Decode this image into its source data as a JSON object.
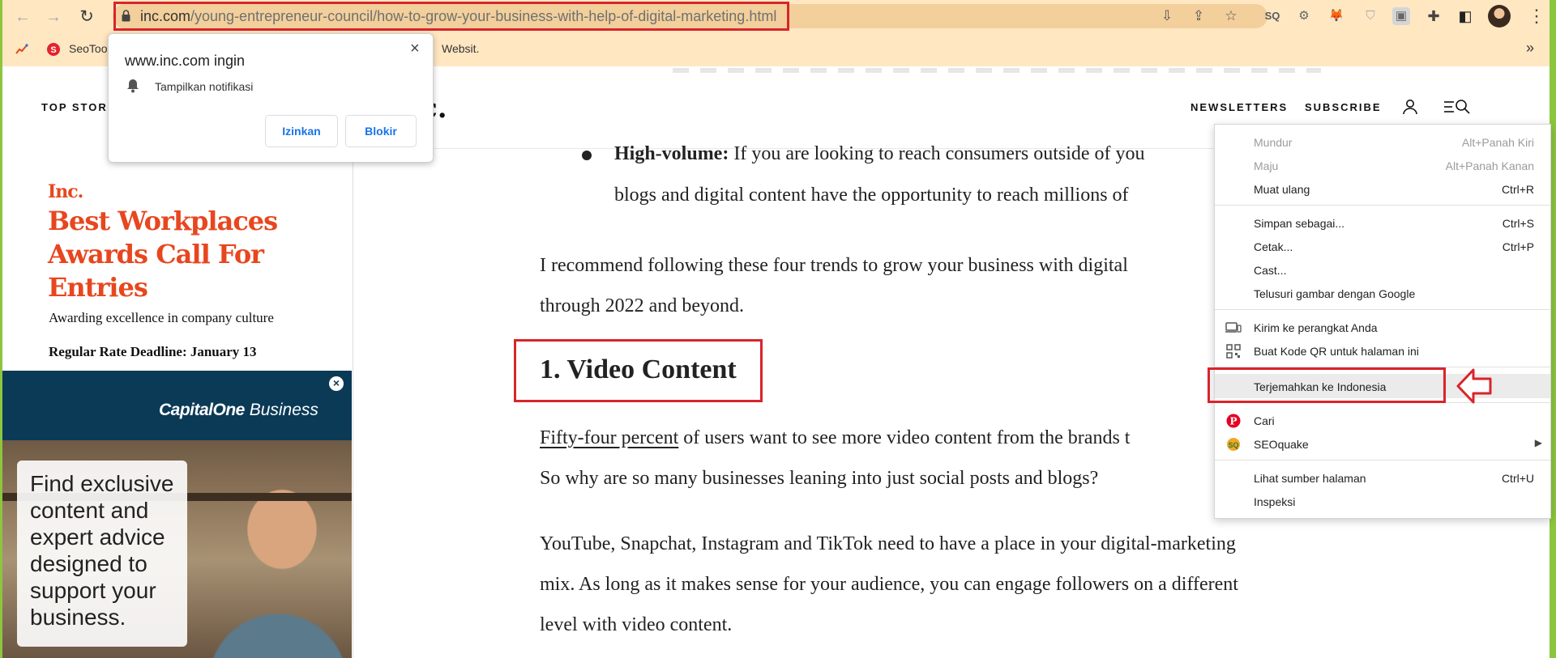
{
  "toolbar": {
    "url_host": "inc.com",
    "url_path": "/young-entrepreneur-council/how-to-grow-your-business-with-help-of-digital-marketing.html",
    "icons": [
      "back-icon",
      "forward-icon",
      "reload-icon",
      "lock-icon",
      "install-icon",
      "share-icon",
      "star-icon",
      "seoquake-icon",
      "extension-gear-icon",
      "metamask-icon",
      "shield-extension-icon",
      "extension-icon",
      "puzzle-icon",
      "side-panel-icon",
      "avatar",
      "kebab-menu-icon"
    ]
  },
  "bookmarks": {
    "items": [
      {
        "label": "SeoToo"
      },
      {
        "label": "Websit."
      }
    ],
    "overflow": "»"
  },
  "notification": {
    "title": "www.inc.com ingin",
    "text": "Tampilkan notifikasi",
    "allow_label": "Izinkan",
    "block_label": "Blokir",
    "close": "×"
  },
  "header": {
    "top_stories": "TOP STOR",
    "logo_tail": "c.",
    "newsletters": "NEWSLETTERS",
    "subscribe": "SUBSCRIBE"
  },
  "promo": {
    "brand": "Inc.",
    "title": "Best Workplaces Awards Call For Entries",
    "subtitle": "Awarding excellence in company culture",
    "deadline": "Regular Rate Deadline: January 13"
  },
  "ad": {
    "brand_a": "CapitalOne",
    "brand_b": "Business",
    "card_text": "Find exclusive content and expert advice designed to support your business."
  },
  "article": {
    "bullet_lead": "High-volume:",
    "bullet_line1": " If you are looking to reach consumers outside of you",
    "bullet_line2": "blogs and digital content have the opportunity to reach millions of",
    "para1_line1": "I recommend following these four trends to grow your business with digital",
    "para1_line2": "through 2022 and beyond.",
    "heading": "1. Video Content",
    "para2_link": "Fifty-four percent",
    "para2_line1_rest": " of users want to see more video content from the brands t",
    "para2_line2": "So why are so many businesses leaning into just social posts and blogs?",
    "para3_line1": "YouTube, Snapchat, Instagram and TikTok need to have a place in your digital-marketing",
    "para3_line2": "mix. As long as it makes sense for your audience, you can engage followers on a different",
    "para3_line3": "level with video content."
  },
  "context_menu": {
    "back": {
      "label": "Mundur",
      "shortcut": "Alt+Panah Kiri"
    },
    "forward": {
      "label": "Maju",
      "shortcut": "Alt+Panah Kanan"
    },
    "reload": {
      "label": "Muat ulang",
      "shortcut": "Ctrl+R"
    },
    "save_as": {
      "label": "Simpan sebagai...",
      "shortcut": "Ctrl+S"
    },
    "print": {
      "label": "Cetak...",
      "shortcut": "Ctrl+P"
    },
    "cast": {
      "label": "Cast..."
    },
    "search_image": {
      "label": "Telusuri gambar dengan Google"
    },
    "send_device": {
      "label": "Kirim ke perangkat Anda"
    },
    "qr_code": {
      "label": "Buat Kode QR untuk halaman ini"
    },
    "translate": {
      "label": "Terjemahkan ke Indonesia"
    },
    "pinterest": {
      "label": "Cari"
    },
    "seoquake": {
      "label": "SEOquake"
    },
    "view_source": {
      "label": "Lihat sumber halaman",
      "shortcut": "Ctrl+U"
    },
    "inspect": {
      "label": "Inspeksi"
    }
  },
  "colors": {
    "toolbar_bg": "#ffe7c2",
    "omnibox_bg": "#f2cf9b",
    "annotation_red": "#d9242b",
    "inc_orange": "#e8461e",
    "ad_navy": "#0b3a57",
    "frame_green": "#8cc63f"
  }
}
